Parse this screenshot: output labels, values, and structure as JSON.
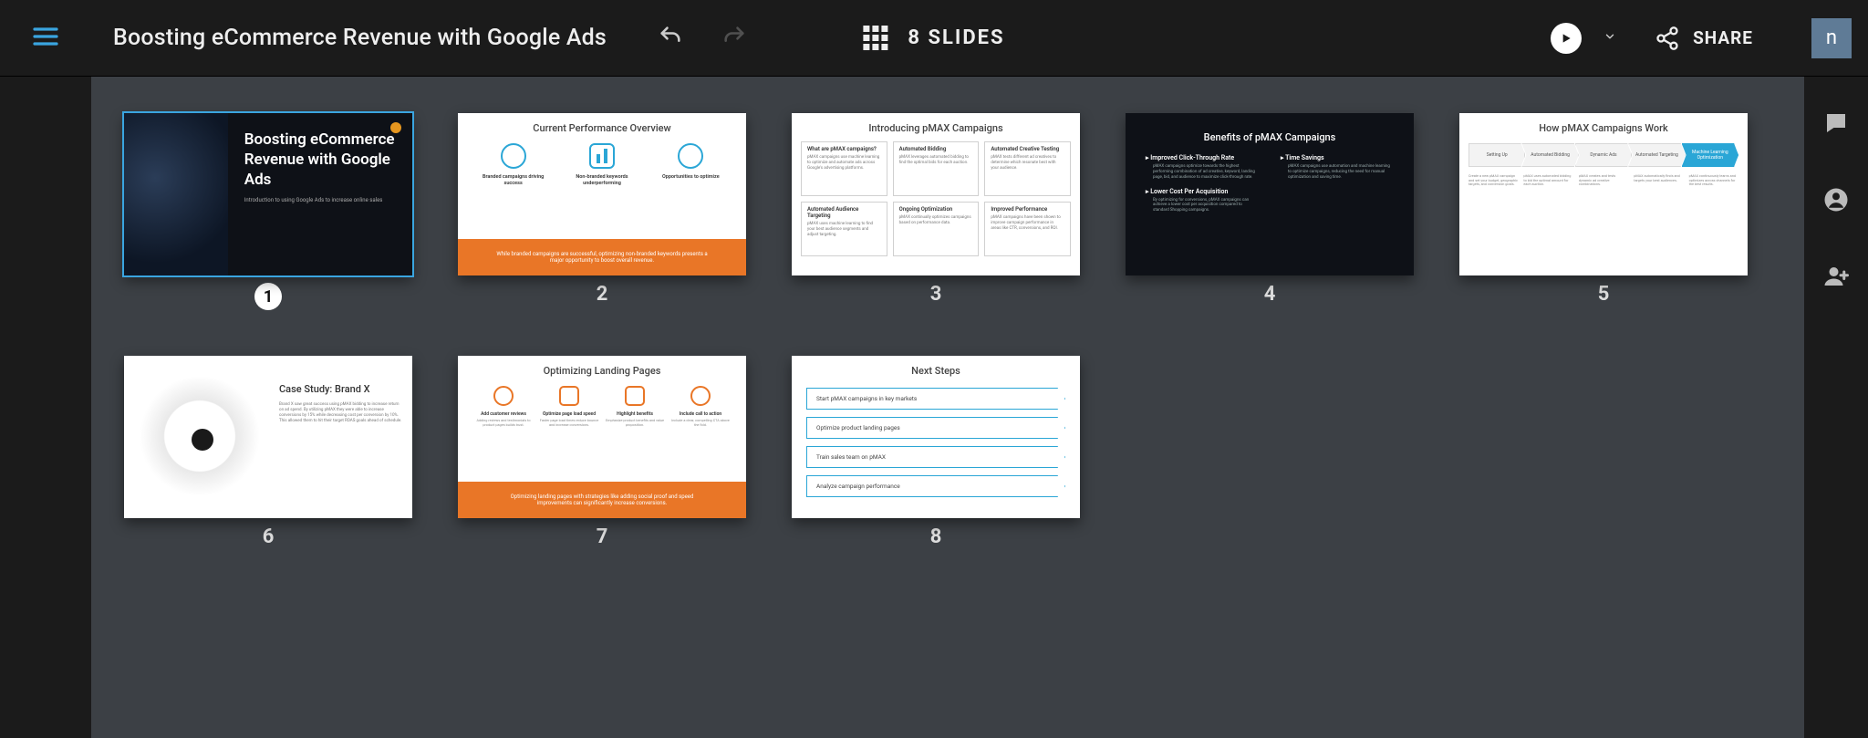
{
  "header": {
    "title": "Boosting eCommerce Revenue with Google Ads",
    "slide_count_label": "8 SLIDES",
    "share_label": "SHARE",
    "avatar_initial": "n"
  },
  "slides": [
    {
      "num": "1",
      "selected": true,
      "kind": "title",
      "title": "Boosting eCommerce Revenue with Google Ads",
      "subtitle": "Introduction to using Google Ads to increase online sales"
    },
    {
      "num": "2",
      "kind": "perf",
      "title": "Current Performance Overview",
      "cols": [
        {
          "head": "Branded campaigns driving success"
        },
        {
          "head": "Non-branded keywords underperforming"
        },
        {
          "head": "Opportunities to optimize"
        }
      ],
      "footer": "While branded campaigns are successful, optimizing non-branded keywords presents a major opportunity to boost overall revenue."
    },
    {
      "num": "3",
      "kind": "grid6",
      "title": "Introducing pMAX Campaigns",
      "cells": [
        {
          "h": "What are pMAX campaigns?",
          "p": "pMAX campaigns use machine learning to optimize and automate ads across Google's advertising platforms."
        },
        {
          "h": "Automated Bidding",
          "p": "pMAX leverages automated bidding to find the optimal bids for each auction."
        },
        {
          "h": "Automated Creative Testing",
          "p": "pMAX tests different ad creatives to determine which resonate best with your audience."
        },
        {
          "h": "Automated Audience Targeting",
          "p": "pMAX uses machine learning to find your best audience segments and adjust targeting."
        },
        {
          "h": "Ongoing Optimization",
          "p": "pMAX continually optimizes campaigns based on performance data."
        },
        {
          "h": "Improved Performance",
          "p": "pMAX campaigns have been shown to improve campaign performance in areas like CTR, conversions, and ROI."
        }
      ]
    },
    {
      "num": "4",
      "kind": "benefits",
      "title": "Benefits of pMAX Campaigns",
      "left": [
        {
          "h": "Improved Click-Through Rate",
          "p": "pMAX campaigns optimize towards the highest performing combination of ad creative, keyword, landing page, bid, and audience to maximize click-through rate."
        },
        {
          "h": "Lower Cost Per Acquisition",
          "p": "By optimizing for conversions, pMAX campaigns can achieve a lower cost per acquisition compared to standard Shopping campaigns."
        }
      ],
      "right": [
        {
          "h": "Time Savings",
          "p": "pMAX campaigns use automation and machine learning to optimize campaigns, reducing the need for manual optimization and saving time."
        }
      ]
    },
    {
      "num": "5",
      "kind": "flow",
      "title": "How pMAX Campaigns Work",
      "steps": [
        {
          "label": "Setting Up",
          "active": false
        },
        {
          "label": "Automated Bidding",
          "active": false
        },
        {
          "label": "Dynamic Ads",
          "active": false
        },
        {
          "label": "Automated Targeting",
          "active": false
        },
        {
          "label": "Machine Learning Optimization",
          "active": true
        }
      ],
      "descs": [
        "Create a new pMAX campaign and set your budget, geographic targets, and conversion goals.",
        "pMAX uses automated bidding to bid the optimal amount for each auction.",
        "pMAX creates and tests dynamic ad creative combinations.",
        "pMAX automatically finds and targets your best audiences.",
        "pMAX continuously learns and optimizes across channels for the best results."
      ]
    },
    {
      "num": "6",
      "kind": "case",
      "title_inner": "Case Study: Brand X",
      "body": "Brand X saw great success using pMAX bidding to increase return on ad spend. By utilizing pMAX they were able to increase conversions by 15% while decreasing cost per conversion by 10%. This allowed them to hit their target ROAS goals ahead of schedule."
    },
    {
      "num": "7",
      "kind": "landing",
      "title": "Optimizing Landing Pages",
      "cols": [
        {
          "h": "Add customer reviews",
          "p": "Adding reviews and testimonials to product pages builds trust."
        },
        {
          "h": "Optimize page load speed",
          "p": "Faster page load times reduce bounce and increase conversions."
        },
        {
          "h": "Highlight benefits",
          "p": "Emphasize product benefits and value proposition."
        },
        {
          "h": "Include call to action",
          "p": "Include a clear, compelling CTA above the fold."
        }
      ],
      "footer": "Optimizing landing pages with strategies like adding social proof and speed improvements can significantly increase conversions."
    },
    {
      "num": "8",
      "kind": "steps",
      "title": "Next Steps",
      "items": [
        "Start pMAX campaigns in key markets",
        "Optimize product landing pages",
        "Train sales team on pMAX",
        "Analyze campaign performance"
      ]
    }
  ]
}
